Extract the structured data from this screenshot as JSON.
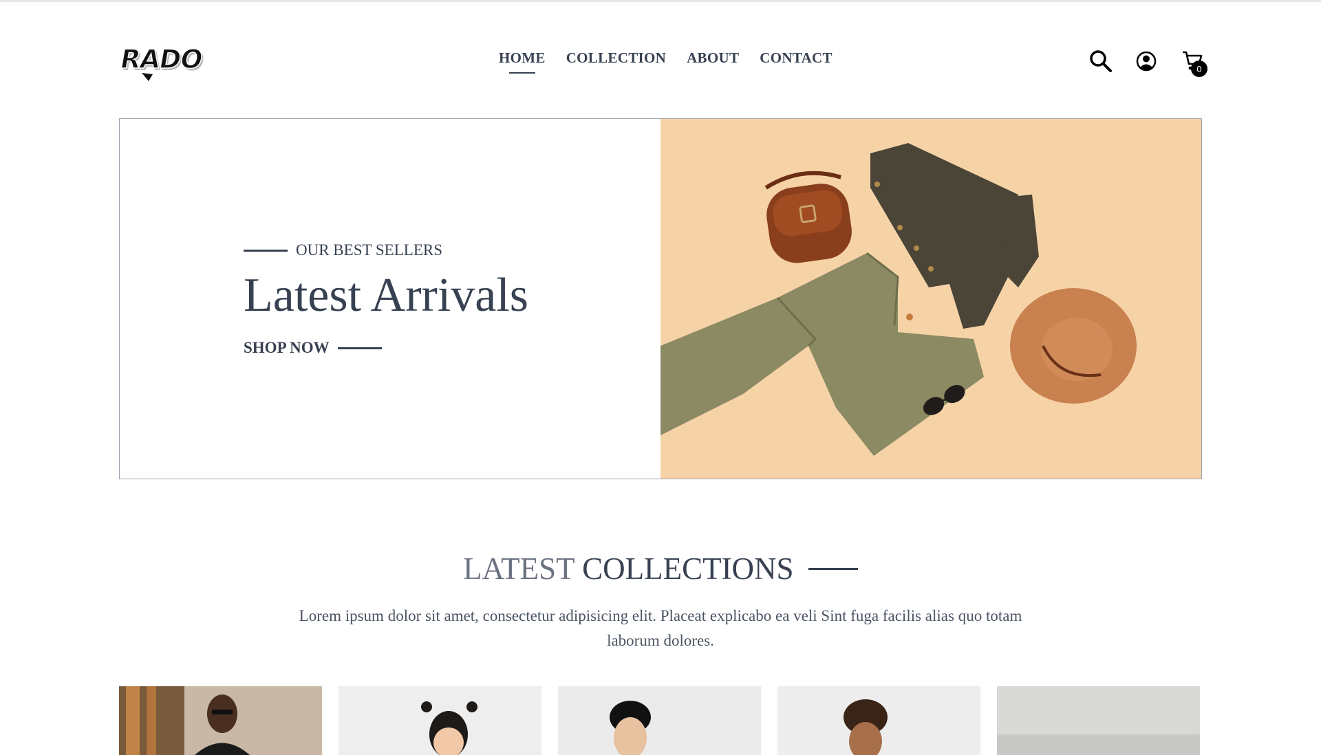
{
  "header": {
    "logo_text": "RADO",
    "nav": [
      {
        "label": "HOME",
        "active": true
      },
      {
        "label": "COLLECTION",
        "active": false
      },
      {
        "label": "ABOUT",
        "active": false
      },
      {
        "label": "CONTACT",
        "active": false
      }
    ],
    "icons": [
      "search-icon",
      "profile-icon",
      "cart-icon"
    ],
    "cart_count": "0"
  },
  "hero": {
    "eyebrow": "OUR BEST SELLERS",
    "title": "Latest Arrivals",
    "cta": "SHOP NOW",
    "image_background": "#f6d3a7"
  },
  "latest": {
    "title_part1": "LATEST",
    "title_part2": "COLLECTIONS",
    "description": "Lorem ipsum dolor sit amet, consectetur adipisicing elit. Placeat explicabo ea veli Sint fuga facilis alias quo totam laborum dolores."
  },
  "colors": {
    "text": "#374151",
    "muted": "#6b7280",
    "border": "#9ca3af",
    "badge": "#000000"
  }
}
